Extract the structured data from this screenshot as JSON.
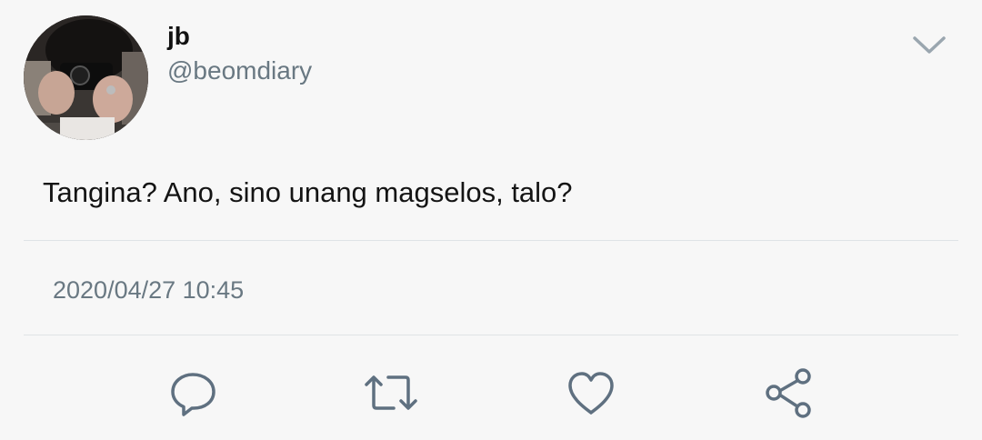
{
  "tweet": {
    "author": {
      "display_name": "jb",
      "handle": "@beomdiary"
    },
    "text": "Tangina? Ano, sino unang magselos, talo?",
    "timestamp": "2020/04/27 10:45"
  },
  "icons": {
    "menu": "chevron-down-icon",
    "reply": "reply-icon",
    "retweet": "retweet-icon",
    "like": "heart-icon",
    "share": "share-icon"
  },
  "colors": {
    "background": "#f7f7f7",
    "text": "#141414",
    "secondary": "#697882",
    "icon": "#5f7080",
    "divider": "#dfe3e6"
  }
}
